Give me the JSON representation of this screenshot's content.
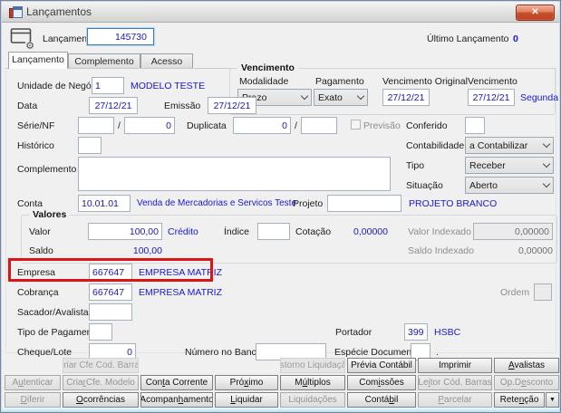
{
  "window": {
    "title": "Lançamentos"
  },
  "icons": {
    "close": "✕",
    "dropdown_arrow": "▼",
    "gear": "⚙"
  },
  "header": {
    "label": "Lançamento",
    "value": "145730",
    "last_label": "Último Lançamento",
    "last_value": "0"
  },
  "tabs": [
    {
      "label": "Lançamento",
      "active": true
    },
    {
      "label": "Complemento",
      "active": false
    },
    {
      "label": "Acesso",
      "active": false
    }
  ],
  "vencimento": {
    "title": "Vencimento",
    "modalidade": {
      "label": "Modalidade",
      "value": "Prazo"
    },
    "pagamento": {
      "label": "Pagamento",
      "value": "Exato"
    },
    "venc_original": {
      "label": "Vencimento Original",
      "value": "27/12/21"
    },
    "venc": {
      "label": "Vencimento",
      "value": "27/12/21",
      "info": "Segunda"
    }
  },
  "form": {
    "unidade": {
      "label": "Unidade de Negócio",
      "value": "1",
      "info": "MODELO TESTE"
    },
    "data": {
      "label": "Data",
      "value": "27/12/21"
    },
    "emissao": {
      "label": "Emissão",
      "value": "27/12/21"
    },
    "serie_nf": {
      "label": "Série/NF",
      "v1": "",
      "sep": "/",
      "v2": "0"
    },
    "duplicata": {
      "label": "Duplicata",
      "v1": "0",
      "sep": "/",
      "v2": ""
    },
    "previsao": {
      "label": "Previsão"
    },
    "conferido": {
      "label": "Conferido",
      "value": ""
    },
    "historico": {
      "label": "Histórico",
      "value": ""
    },
    "contabilidade": {
      "label": "Contabilidade",
      "value": "a Contabilizar"
    },
    "complemento": {
      "label": "Complemento",
      "value": ""
    },
    "tipo": {
      "label": "Tipo",
      "value": "Receber"
    },
    "situacao": {
      "label": "Situação",
      "value": "Aberto"
    },
    "conta": {
      "label": "Conta",
      "value": "10.01.01",
      "info": "Venda de Mercadorias e Servicos Teste"
    },
    "projeto": {
      "label": "Projeto",
      "value": "",
      "info": "PROJETO BRANCO"
    },
    "empresa": {
      "label": "Empresa",
      "value": "667647",
      "info": "EMPRESA MATRIZ"
    },
    "cobranca": {
      "label": "Cobrança",
      "value": "667647",
      "info": "EMPRESA MATRIZ"
    },
    "ordem": {
      "label": "Ordem",
      "value": ""
    },
    "sacador": {
      "label": "Sacador/Avalista",
      "value": ""
    },
    "tipo_pagamento": {
      "label": "Tipo de Pagamento",
      "value": ""
    },
    "portador": {
      "label": "Portador",
      "value": "399",
      "info": "HSBC"
    },
    "cheque_lote": {
      "label": "Cheque/Lote",
      "value": "0"
    },
    "numero_banco": {
      "label": "Número no Banco",
      "value": ""
    },
    "especie": {
      "label": "Espécie Documento",
      "value": "",
      "suffix": "."
    }
  },
  "valores": {
    "title": "Valores",
    "valor": {
      "label": "Valor",
      "value": "100,00",
      "info": "Crédito"
    },
    "indice": {
      "label": "Índice",
      "value": ""
    },
    "cotacao": {
      "label": "Cotação",
      "value": "0,00000"
    },
    "valor_indexado": {
      "label": "Valor Indexado",
      "value": "0,00000"
    },
    "saldo": {
      "label": "Saldo",
      "value": "100,00"
    },
    "saldo_indexado": {
      "label": "Saldo Indexado",
      "value": "0,00000"
    }
  },
  "buttons": {
    "rows": [
      [
        {
          "state": "empty"
        },
        {
          "label": "Criar Cfe Cod. Barras",
          "state": "flat",
          "u": null
        },
        {
          "state": "empty"
        },
        {
          "state": "empty"
        },
        {
          "label": "Estorno Liquidação",
          "state": "flat",
          "u": null
        },
        {
          "label": "Prévia Contábil",
          "state": "enabled",
          "u": null
        },
        {
          "label": "Imprimir",
          "state": "enabled",
          "u": null
        },
        {
          "label": "Avalistas",
          "state": "enabled",
          "u": 0
        }
      ],
      [
        {
          "label": "Autenticar",
          "state": "disabled",
          "u": 1
        },
        {
          "label": "Criar Cfe. Modelo",
          "state": "disabled",
          "u": 4
        },
        {
          "label": "Conta Corrente",
          "state": "enabled",
          "u": 3
        },
        {
          "label": "Próximo",
          "state": "enabled",
          "u": 3
        },
        {
          "label": "Múltiplos",
          "state": "enabled",
          "u": 1
        },
        {
          "label": "Comissões",
          "state": "enabled",
          "u": 3
        },
        {
          "label": "Leitor Cód. Barras",
          "state": "disabled",
          "u": 2
        },
        {
          "label": "Op.Desconto",
          "state": "disabled",
          "u": 4
        }
      ],
      [
        {
          "label": "Diferir",
          "state": "disabled",
          "u": 0
        },
        {
          "label": "Ocorrências",
          "state": "enabled",
          "u": 0
        },
        {
          "label": "Acompanhamento",
          "state": "enabled",
          "u": 7
        },
        {
          "label": "Liquidar",
          "state": "enabled",
          "u": 0
        },
        {
          "label": "Liquidações",
          "state": "disabled",
          "u": null
        },
        {
          "label": "Contábil",
          "state": "enabled",
          "u": 5
        },
        {
          "label": "Parcelar",
          "state": "disabled",
          "u": 0
        },
        {
          "label": "Retenção",
          "state": "enabled",
          "u": 4,
          "split": true
        }
      ]
    ]
  },
  "colors": {
    "value_text": "#1717c0",
    "info_text": "#1717dd",
    "highlight_red": "#dd1414",
    "focus_border": "#3c7fb1",
    "dialog_bg": "#f0f0f0"
  }
}
